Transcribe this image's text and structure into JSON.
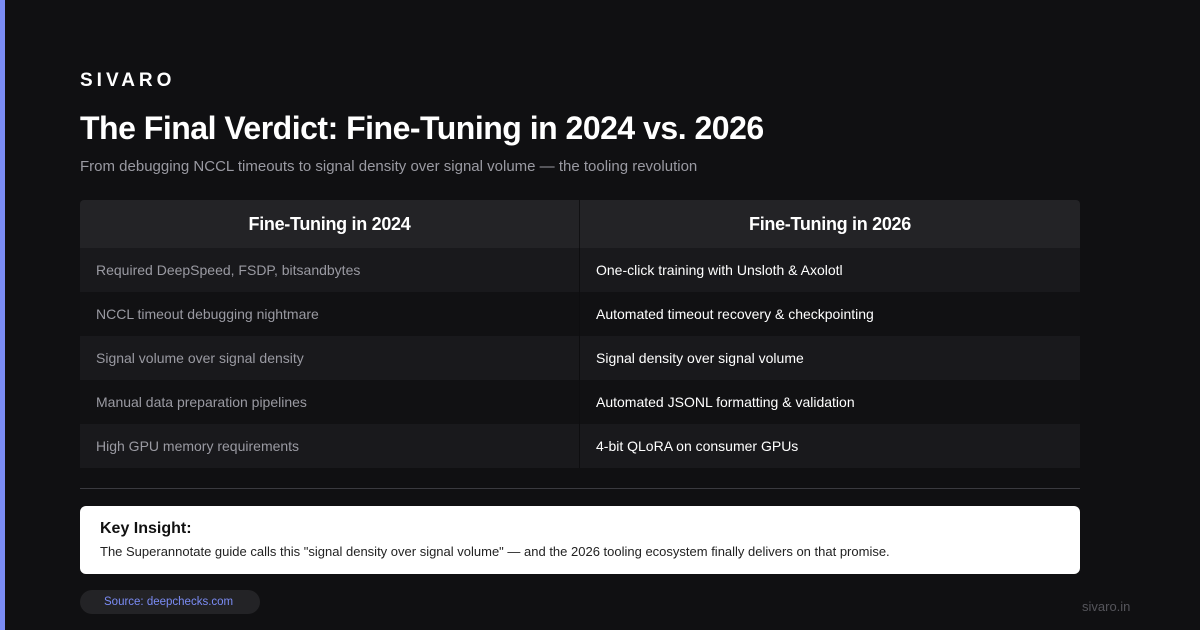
{
  "brand": "SIVARO",
  "title": "The Final Verdict: Fine-Tuning in 2024 vs. 2026",
  "subtitle": "From debugging NCCL timeouts to signal density over signal volume — the tooling revolution",
  "table": {
    "headers": [
      "Fine-Tuning in 2024",
      "Fine-Tuning in 2026"
    ],
    "rows": [
      [
        "Required DeepSpeed, FSDP, bitsandbytes",
        "One-click training with Unsloth & Axolotl"
      ],
      [
        "NCCL timeout debugging nightmare",
        "Automated timeout recovery & checkpointing"
      ],
      [
        "Signal volume over signal density",
        "Signal density over signal volume"
      ],
      [
        "Manual data preparation pipelines",
        "Automated JSONL formatting & validation"
      ],
      [
        "High GPU memory requirements",
        "4-bit QLoRA on consumer GPUs"
      ]
    ]
  },
  "insight": {
    "title": "Key Insight:",
    "text": "The Superannotate guide calls this \"signal density over signal volume\" — and the 2026 tooling ecosystem finally delivers on that promise."
  },
  "source": "Source: deepchecks.com",
  "site": "sivaro.in",
  "colors": {
    "background": "#101012",
    "accent": "#7b8cf5",
    "header_bg": "#232326",
    "insight_bg": "#ffffff"
  }
}
